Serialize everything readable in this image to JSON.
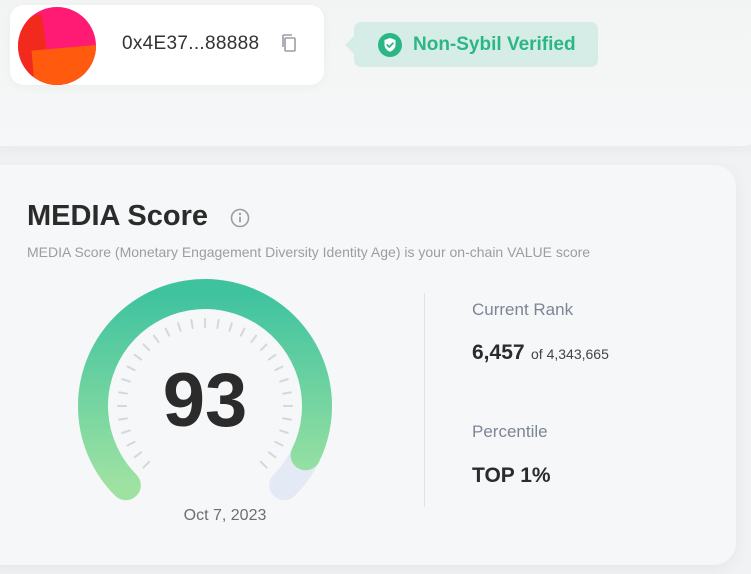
{
  "wallet": {
    "address": "0x4E37...88888",
    "verified_label": "Non-Sybil Verified",
    "avatar_colors": [
      "#ff1a73",
      "#f2291d",
      "#ff5a0d"
    ]
  },
  "media_score": {
    "title": "MEDIA Score",
    "description": "MEDIA Score (Monetary Engagement Diversity Identity Age) is your on-chain VALUE score",
    "score": "93",
    "date": "Oct 7, 2023",
    "current_rank_label": "Current Rank",
    "rank": "6,457",
    "rank_total": "of 4,343,665",
    "percentile_label": "Percentile",
    "percentile": "TOP 1%"
  },
  "gauge": {
    "fill_fraction": 0.93,
    "gradient_start": "#9ee2a2",
    "gradient_end": "#3fc39f",
    "track_color": "#e4e9f6",
    "tick_color": "#d5d7da"
  },
  "icons": {
    "copy": "copy-icon",
    "shield": "shield-check-icon",
    "info": "info-icon"
  },
  "colors": {
    "accent_green": "#2bb785",
    "badge_bg": "#d5ede6",
    "text_dark": "#2b2b2b",
    "text_muted": "#9a9ea3"
  }
}
